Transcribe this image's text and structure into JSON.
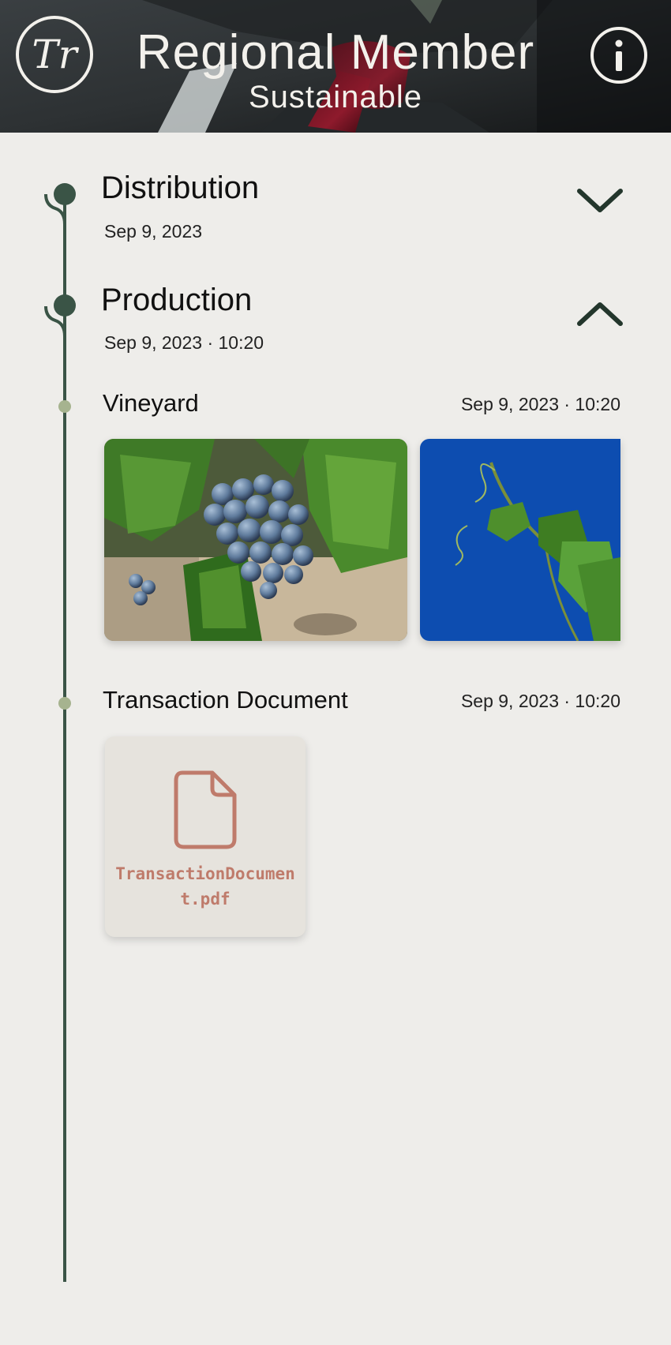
{
  "header": {
    "logo_text": "Tr",
    "title": "Regional Member",
    "subtitle": "Sustainable",
    "info_icon": "info-circle-icon"
  },
  "colors": {
    "timeline": "#3a5446",
    "timeline_dot_minor": "#a6b38f",
    "document_accent": "#bf7b6b",
    "background": "#eeedea"
  },
  "timeline": {
    "sections": [
      {
        "title": "Distribution",
        "date": "Sep 9, 2023",
        "toggle_icon": "chevron-down-icon",
        "expanded": false
      },
      {
        "title": "Production",
        "date": "Sep 9, 2023 · 10:20",
        "toggle_icon": "chevron-up-icon",
        "expanded": true,
        "entries": [
          {
            "title": "Vineyard",
            "date": "Sep 9, 2023 · 10:20",
            "photos": [
              "grape-cluster-photo",
              "vine-branch-photo"
            ]
          },
          {
            "title": "Transaction Document",
            "date": "Sep 9, 2023 · 10:20",
            "file": {
              "icon": "file-icon",
              "name": "TransactionDocument.pdf"
            }
          }
        ]
      }
    ]
  }
}
